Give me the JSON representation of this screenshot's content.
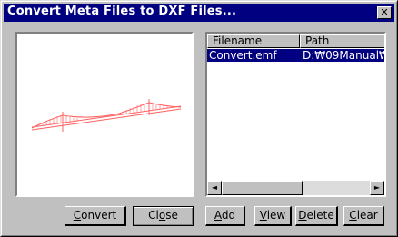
{
  "window": {
    "title": "Convert Meta Files to DXF Files...",
    "close_glyph": "✕"
  },
  "listview": {
    "columns": [
      "Filename",
      "Path"
    ],
    "rows": [
      {
        "filename": "Convert.emf",
        "path": "D:₩09Manual₩"
      }
    ],
    "selected_row": 0
  },
  "scrollbar": {
    "left_arrow": "◄",
    "right_arrow": "►"
  },
  "buttons": {
    "convert": {
      "label": "Convert",
      "mnemonic_index": 0
    },
    "close": {
      "label": "Close",
      "mnemonic_index": 2
    },
    "add": {
      "label": "Add",
      "mnemonic_index": 0
    },
    "view": {
      "label": "View",
      "mnemonic_index": 0
    },
    "delete": {
      "label": "Delete",
      "mnemonic_index": 0
    },
    "clear": {
      "label": "Clear",
      "mnemonic_index": 0
    }
  },
  "colors": {
    "titlebar": "#000080",
    "selection": "#000080",
    "preview_stroke": "#ff6060"
  }
}
